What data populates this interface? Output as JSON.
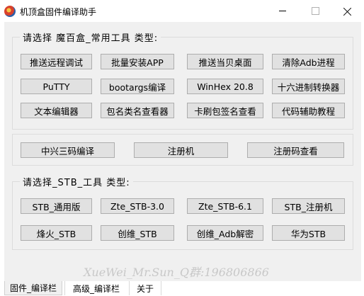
{
  "window": {
    "title": "机顶盒固件编译助手"
  },
  "group1": {
    "title": "请选择 魔百盒_常用工具 类型:",
    "buttons": [
      "推送远程调试",
      "批量安装APP",
      "推送当贝桌面",
      "清除Adb进程",
      "PuTTY",
      "bootargs编译",
      "WinHex 20.8",
      "十六进制转换器",
      "文本编辑器",
      "包名类名查看器",
      "卡刷包签名查看",
      "代码辅助教程"
    ]
  },
  "group2": {
    "buttons": [
      "中兴三码编译",
      "注册机",
      "注册码查看"
    ]
  },
  "group3": {
    "title": "请选择_STB_工具 类型:",
    "buttons": [
      "STB_通用版",
      "Zte_STB-3.0",
      "Zte_STB-6.1",
      "STB_注册机",
      "烽火_STB",
      "创维_STB",
      "创维_Adb解密",
      "华为STB"
    ]
  },
  "watermark": "XueWei_Mr.Sun_Q群:196806866",
  "tabs": [
    "固件_编译栏",
    "高级_编译栏",
    "关于"
  ],
  "icons": {
    "app": "app-logo-icon",
    "minimize": "minimize-icon",
    "maximize": "maximize-icon",
    "close": "close-icon"
  }
}
